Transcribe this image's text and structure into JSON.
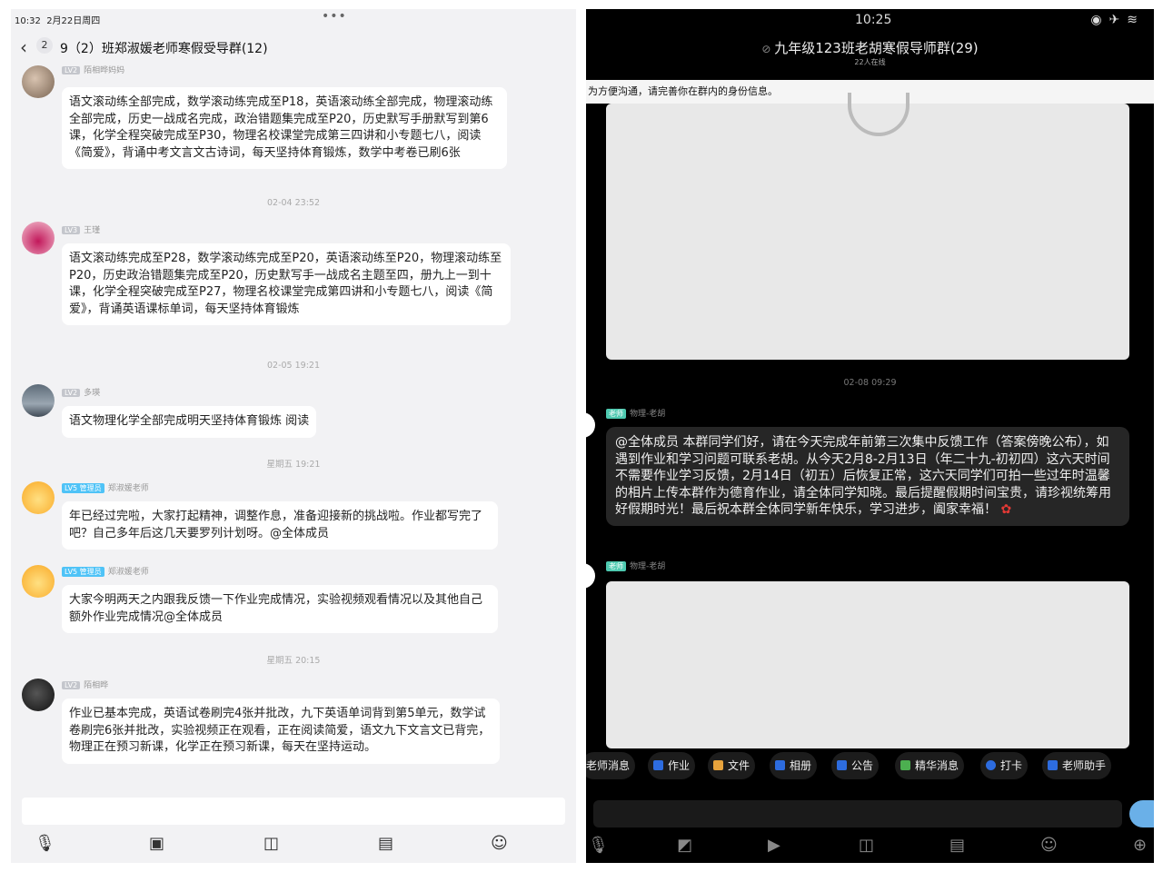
{
  "left": {
    "status_time": "10:32",
    "status_date": "2月22日周四",
    "unread_count": "2",
    "title": "9（2）班郑淑媛老师寒假受导群(12)",
    "messages": [
      {
        "level": "LV2",
        "name": "陌相晔妈妈",
        "text": "语文滚动练全部完成，数学滚动练完成至P18，英语滚动练全部完成，物理滚动练全部完成，历史一战成名完成，政治错题集完成至P20，历史默写手册默写到第6课，化学全程突破完成至P30，物理名校课堂完成第三四讲和小专题七八，阅读《简爱》，背诵中考文言文古诗词，每天坚持体育锻炼，数学中考卷已刷6张"
      },
      {
        "time": "02-04 23:52",
        "level": "LV3",
        "name": "王瑾",
        "text": "语文滚动练完成至P28，数学滚动练完成至P20，英语滚动练至P20，物理滚动练至P20，历史政治错题集完成至P20，历史默写手一战成名主题至四，册九上一到十课，化学全程突破完成至P27，物理名校课堂完成第四讲和小专题七八，阅读《简爱》，背诵英语课标单词，每天坚持体育锻炼"
      },
      {
        "time": "02-05 19:21",
        "level": "LV2",
        "name": "多瑛",
        "text": "语文物理化学全部完成明天坚持体育锻炼 阅读"
      },
      {
        "time": "星期五 19:21",
        "level": "LV5 管理员",
        "name": "郑淑媛老师",
        "text": "年已经过完啦，大家打起精神，调整作息，准备迎接新的挑战啦。作业都写完了吧？自己多年后这几天要罗列计划呀。@全体成员"
      },
      {
        "level": "LV5 管理员",
        "name": "郑淑媛老师",
        "text": "大家今明两天之内跟我反馈一下作业完成情况，实验视频观看情况以及其他自己额外作业完成情况@全体成员"
      },
      {
        "time": "星期五 20:15",
        "level": "LV2",
        "name": "陌相晔",
        "text": "作业已基本完成，英语试卷刷完4张并批改，九下英语单词背到第5单元，数学试卷刷完6张并批改，实验视频正在观看，正在阅读简爱，语文九下文言文已背完，物理正在预习新课，化学正在预习新课，每天在坚持运动。"
      }
    ]
  },
  "right": {
    "status_time": "10:25",
    "title": "九年级123班老胡寒假导师群(29)",
    "subtitle": "22人在线",
    "notice": "为方便沟通，请完善你在群内的身份信息。",
    "time1": "02-08 09:29",
    "badge": "老师",
    "sender": "物理-老胡",
    "message": "@全体成员 本群同学们好，请在今天完成年前第三次集中反馈工作（答案傍晚公布），如遇到作业和学习问题可联系老胡。从今天2月8-2月13日（年二十九-初初四）这六天时间不需要作业学习反馈，2月14日（初五）后恢复正常，这六天同学们可拍一些过年时温馨的相片上传本群作为德育作业，请全体同学知晓。最后提醒假期时间宝贵，请珍视统筹用好假期时光！最后祝本群全体同学新年快乐，学习进步，阖家幸福！",
    "tabs": [
      {
        "label": "老师消息",
        "color": "#2d6cdf"
      },
      {
        "label": "作业",
        "color": "#2d6cdf"
      },
      {
        "label": "文件",
        "color": "#e6a23c"
      },
      {
        "label": "相册",
        "color": "#2d6cdf"
      },
      {
        "label": "公告",
        "color": "#2d6cdf"
      },
      {
        "label": "精华消息",
        "color": "#4caf50"
      },
      {
        "label": "打卡",
        "color": "#2d6cdf"
      },
      {
        "label": "老师助手",
        "color": "#2d6cdf"
      }
    ]
  }
}
